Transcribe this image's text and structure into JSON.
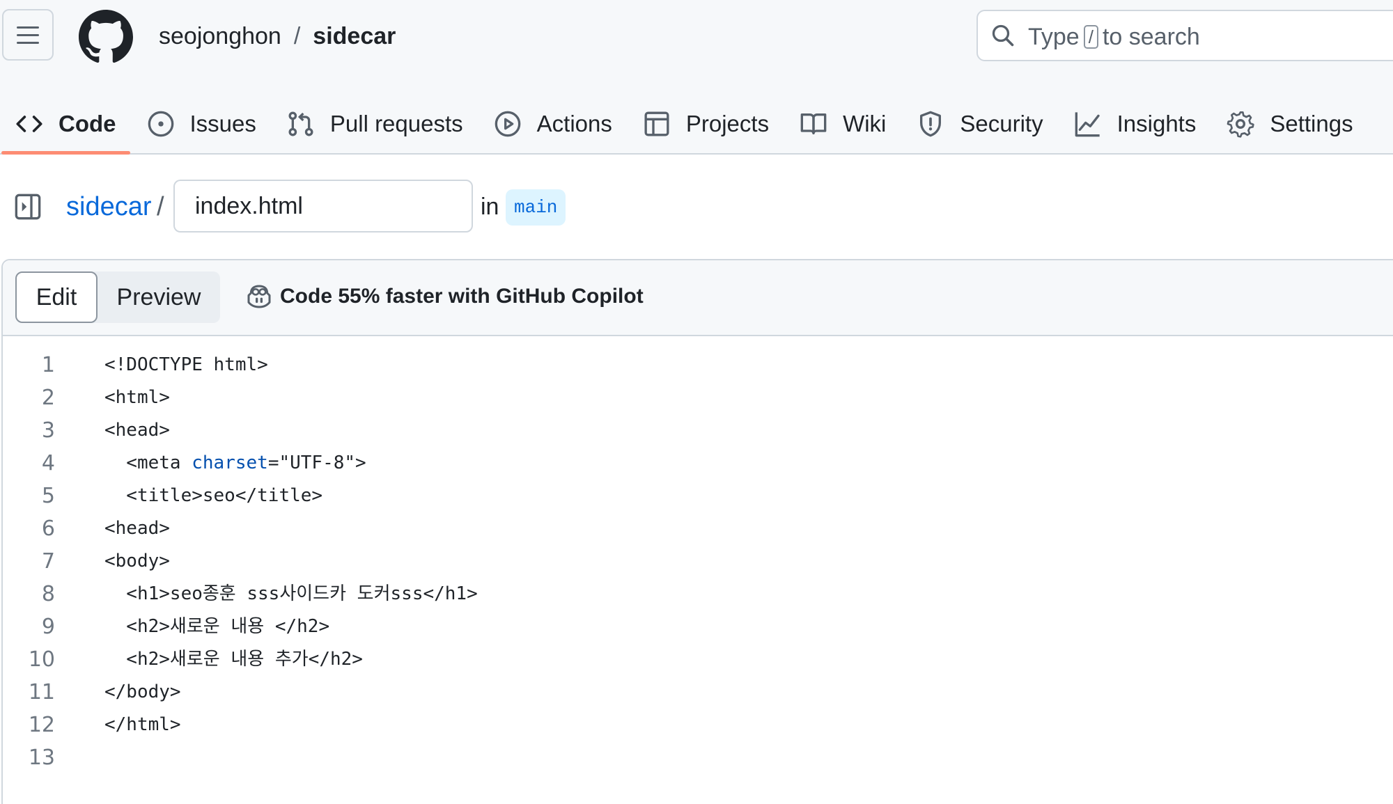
{
  "header": {
    "owner": "seojonghon",
    "separator": "/",
    "repo": "sidecar",
    "search": {
      "before": "Type",
      "key": "/",
      "after": "to search"
    }
  },
  "tabs": [
    {
      "label": "Code",
      "icon": "code-icon",
      "active": true
    },
    {
      "label": "Issues",
      "icon": "issue-opened-icon"
    },
    {
      "label": "Pull requests",
      "icon": "git-pull-request-icon"
    },
    {
      "label": "Actions",
      "icon": "play-icon"
    },
    {
      "label": "Projects",
      "icon": "table-icon"
    },
    {
      "label": "Wiki",
      "icon": "book-icon"
    },
    {
      "label": "Security",
      "icon": "shield-icon"
    },
    {
      "label": "Insights",
      "icon": "graph-icon"
    },
    {
      "label": "Settings",
      "icon": "gear-icon"
    }
  ],
  "path": {
    "repo": "sidecar",
    "separator": "/",
    "filename": "index.html",
    "in_label": "in",
    "branch": "main"
  },
  "editor": {
    "edit_label": "Edit",
    "preview_label": "Preview",
    "copilot_text": "Code 55% faster with GitHub Copilot",
    "lines": [
      {
        "n": "1",
        "code": "<!DOCTYPE html>"
      },
      {
        "n": "2",
        "code": "<html>"
      },
      {
        "n": "3",
        "code": "<head>"
      },
      {
        "n": "4",
        "code": "  <meta charset=\"UTF-8\">"
      },
      {
        "n": "5",
        "code": "  <title>seo</title>"
      },
      {
        "n": "6",
        "code": "<head>"
      },
      {
        "n": "7",
        "code": "<body>"
      },
      {
        "n": "8",
        "code": "  <h1>seo종훈 sss사이드카 도커sss</h1>"
      },
      {
        "n": "9",
        "code": "  <h2>새로운 내용 </h2>"
      },
      {
        "n": "10",
        "code": "  <h2>새로운 내용 추가</h2>"
      },
      {
        "n": "11",
        "code": "</body>"
      },
      {
        "n": "12",
        "code": "</html>"
      },
      {
        "n": "13",
        "code": ""
      }
    ]
  },
  "colors": {
    "accent_link": "#0969da",
    "active_tab_underline": "#fd8c73",
    "branch_bg": "#ddf4ff",
    "attribute": "#0550ae"
  }
}
